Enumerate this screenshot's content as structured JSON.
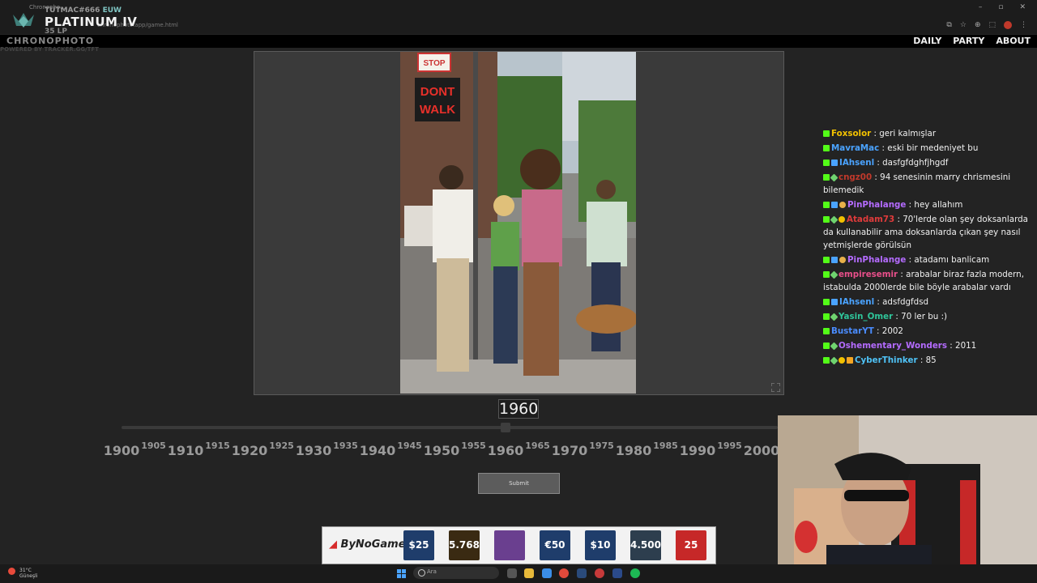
{
  "browser": {
    "tab_title": "Chronopho...",
    "url": "chronophoto.app/game.html"
  },
  "rank_overlay": {
    "username": "TUTMAC#666",
    "server": "EUW",
    "rank": "PLATINUM IV",
    "lp": "35 LP",
    "powered_by": "POWERED BY TRACKER.GG/TFT"
  },
  "site": {
    "logo": "CHRONOPHOTO",
    "nav": [
      "DAILY",
      "PARTY",
      "ABOUT"
    ]
  },
  "photo_signs": {
    "stop": "STOP",
    "dont": "DONT",
    "walk": "WALK"
  },
  "game": {
    "selected_year": "1960",
    "slider_min": 1900,
    "slider_max": 2000,
    "slider_value": 1960,
    "ticks_major": [
      "1900",
      "1910",
      "1920",
      "1930",
      "1940",
      "1950",
      "1960",
      "1970",
      "1980",
      "1990",
      "2000"
    ],
    "ticks_minor": [
      "1905",
      "1915",
      "1925",
      "1935",
      "1945",
      "1955",
      "1965",
      "1975",
      "1985",
      "1995"
    ],
    "submit_label": "Submit"
  },
  "chat": {
    "messages": [
      {
        "user": "Foxsolor",
        "color": "#f2c100",
        "badges": [
          "k"
        ],
        "text": " : geri kalmışlar"
      },
      {
        "user": "MavraMac",
        "color": "#4aa3ff",
        "badges": [
          "k"
        ],
        "text": " : eski bir medeniyet bu"
      },
      {
        "user": "IAhsenl",
        "color": "#4aa3ff",
        "badges": [
          "k",
          "v"
        ],
        "text": " : dasfgfdghfjhgdf"
      },
      {
        "user": "cngz00",
        "color": "#c0392b",
        "badges": [
          "k",
          "p"
        ],
        "text": " : 94 senesinin marry chrismesini bilemedik"
      },
      {
        "user": "PinPhalange",
        "color": "#b46bff",
        "badges": [
          "k",
          "v",
          "s"
        ],
        "text": " : hey allahım"
      },
      {
        "user": "Atadam73",
        "color": "#e03b3b",
        "badges": [
          "k",
          "p",
          "g"
        ],
        "text": " : 70'lerde olan şey doksanlarda da kullanabilir ama doksanlarda çıkan şey nasıl yetmişlerde görülsün"
      },
      {
        "user": "PinPhalange",
        "color": "#b46bff",
        "badges": [
          "k",
          "v",
          "s"
        ],
        "text": " : atadamı banlicam"
      },
      {
        "user": "empiresemir",
        "color": "#e84f8a",
        "badges": [
          "k",
          "p"
        ],
        "text": " : arabalar biraz fazla modern, istabulda 2000lerde bile böyle arabalar vardı"
      },
      {
        "user": "IAhsenl",
        "color": "#4aa3ff",
        "badges": [
          "k",
          "v"
        ],
        "text": " : adsfdgfdsd"
      },
      {
        "user": "Yasin_Omer",
        "color": "#2fc59a",
        "badges": [
          "k",
          "p"
        ],
        "text": " : 70 ler bu :)"
      },
      {
        "user": "BustarYT",
        "color": "#4a8cff",
        "badges": [
          "k"
        ],
        "text": " : 2002"
      },
      {
        "user": "Oshementary_Wonders",
        "color": "#b46bff",
        "badges": [
          "k",
          "p"
        ],
        "text": " : 2011"
      },
      {
        "user": "CyberThinker",
        "color": "#4fc3f7",
        "badges": [
          "k",
          "p",
          "g",
          "c"
        ],
        "text": " : 85"
      }
    ]
  },
  "ad": {
    "brand": "ByNoGame",
    "cards": [
      {
        "label": "$25",
        "color": "#1f3d6b"
      },
      {
        "label": "5.768",
        "color": "#3a2a12"
      },
      {
        "label": "",
        "color": "#6a3f8f"
      },
      {
        "label": "€50",
        "color": "#1f3d6b"
      },
      {
        "label": "$10",
        "color": "#1f3d6b"
      },
      {
        "label": "4.500",
        "color": "#2d3e4e"
      },
      {
        "label": "25",
        "color": "#c62828"
      }
    ]
  },
  "taskbar": {
    "temperature": "31°C",
    "weather": "Güneşli",
    "search_placeholder": "Ara"
  }
}
